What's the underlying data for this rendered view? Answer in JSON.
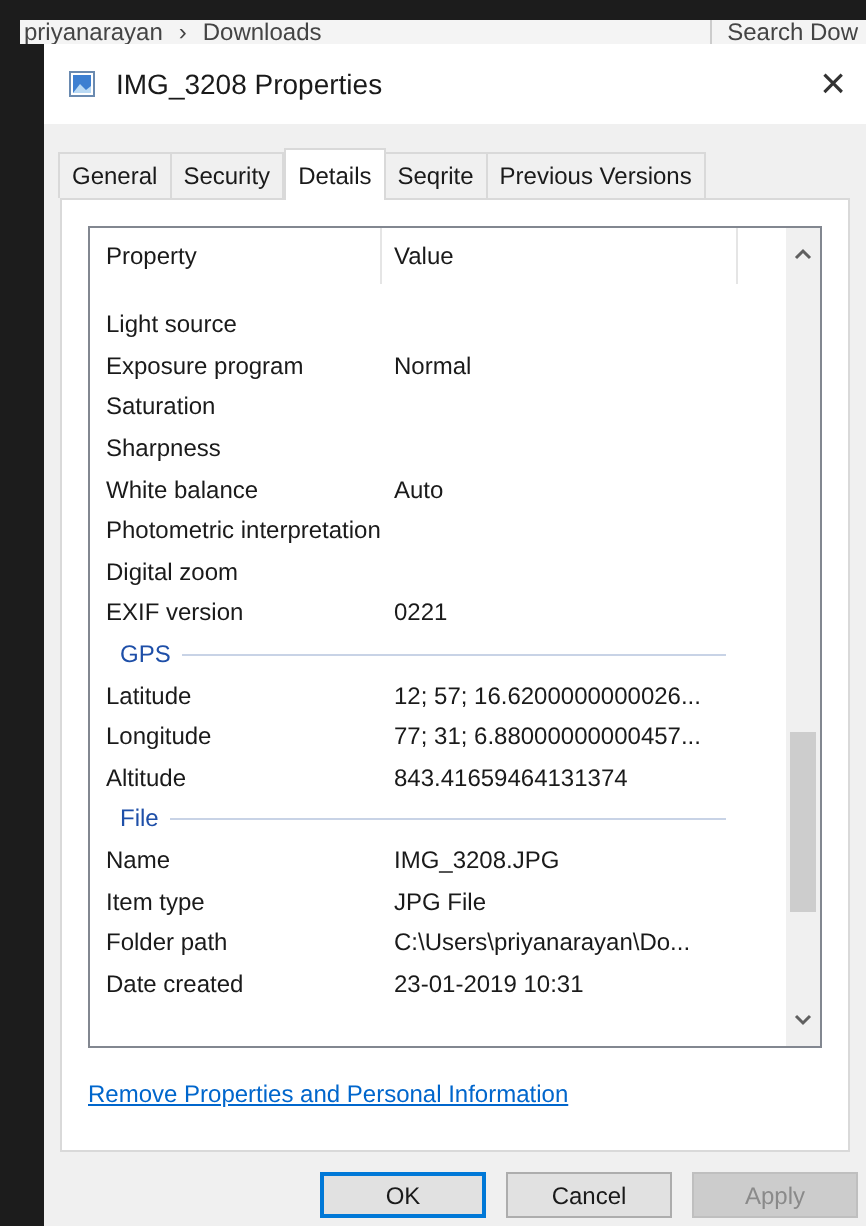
{
  "explorer_bar": {
    "path": "priyanarayan",
    "separator": "›",
    "folder": "Downloads",
    "search": "Search Dow"
  },
  "window": {
    "title": "IMG_3208 Properties",
    "close": "×"
  },
  "tabs": [
    {
      "label": "General",
      "selected": false
    },
    {
      "label": "Security",
      "selected": false
    },
    {
      "label": "Details",
      "selected": true
    },
    {
      "label": "Seqrite",
      "selected": false
    },
    {
      "label": "Previous Versions",
      "selected": false
    }
  ],
  "table": {
    "columns": [
      "Property",
      "Value"
    ],
    "rows": [
      {
        "kind": "row",
        "property": "Light source",
        "value": ""
      },
      {
        "kind": "row",
        "property": "Exposure program",
        "value": "Normal"
      },
      {
        "kind": "row",
        "property": "Saturation",
        "value": ""
      },
      {
        "kind": "row",
        "property": "Sharpness",
        "value": ""
      },
      {
        "kind": "row",
        "property": "White balance",
        "value": "Auto"
      },
      {
        "kind": "row",
        "property": "Photometric interpretation",
        "value": ""
      },
      {
        "kind": "row",
        "property": "Digital zoom",
        "value": ""
      },
      {
        "kind": "row",
        "property": "EXIF version",
        "value": "0221"
      },
      {
        "kind": "group",
        "property": "GPS"
      },
      {
        "kind": "row",
        "property": "Latitude",
        "value": "12; 57; 16.6200000000026..."
      },
      {
        "kind": "row",
        "property": "Longitude",
        "value": "77; 31; 6.88000000000457..."
      },
      {
        "kind": "row",
        "property": "Altitude",
        "value": "843.41659464131374"
      },
      {
        "kind": "group",
        "property": "File"
      },
      {
        "kind": "row",
        "property": "Name",
        "value": "IMG_3208.JPG"
      },
      {
        "kind": "row",
        "property": "Item type",
        "value": "JPG File"
      },
      {
        "kind": "row",
        "property": "Folder path",
        "value": "C:\\Users\\priyanarayan\\Do..."
      },
      {
        "kind": "row",
        "property": "Date created",
        "value": "23-01-2019 10:31"
      }
    ]
  },
  "link": "Remove Properties and Personal Information",
  "buttons": [
    {
      "label": "OK",
      "disabled": false,
      "default": true
    },
    {
      "label": "Cancel",
      "disabled": false,
      "default": false
    },
    {
      "label": "Apply",
      "disabled": true,
      "default": false
    }
  ]
}
